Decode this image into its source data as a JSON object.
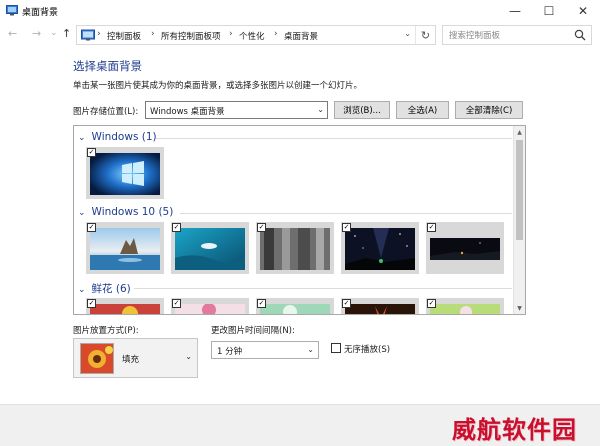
{
  "window": {
    "title": "桌面背景",
    "controls": {
      "minimize": "—",
      "maximize": "☐",
      "close": "✕"
    }
  },
  "nav": {
    "back": "←",
    "forward": "→",
    "recent": "⌄",
    "up": "↑",
    "breadcrumb": [
      "控制面板",
      "所有控制面板项",
      "个性化",
      "桌面背景"
    ],
    "separator": "›",
    "refresh": "↻",
    "search_placeholder": "搜索控制面板"
  },
  "help": "?",
  "main": {
    "heading": "选择桌面背景",
    "description": "单击某一张图片使其成为你的桌面背景，或选择多张图片以创建一个幻灯片。",
    "location_label": "图片存储位置(L):",
    "location_value": "Windows 桌面背景",
    "browse_button": "浏览(B)...",
    "select_all_button": "全选(A)",
    "clear_all_button": "全部清除(C)"
  },
  "gallery": {
    "groups": [
      {
        "title": "Windows (1)",
        "count": 1
      },
      {
        "title": "Windows 10 (5)",
        "count": 5
      },
      {
        "title": "鲜花 (6)",
        "count": 6
      }
    ],
    "checkmark": "✓",
    "scroll_up": "▲",
    "scroll_down": "▼"
  },
  "position": {
    "label": "图片放置方式(P):",
    "value": "填充"
  },
  "interval": {
    "label": "更改图片时间间隔(N):",
    "value": "1 分钟"
  },
  "shuffle": {
    "label": "无序播放(S)",
    "checked": false
  },
  "dropdown_arrow": "⌄",
  "watermark": "威航软件园",
  "colors": {
    "heading": "#1e3d8f",
    "watermark": "#c8102e",
    "footer": "#f0f0f0"
  }
}
